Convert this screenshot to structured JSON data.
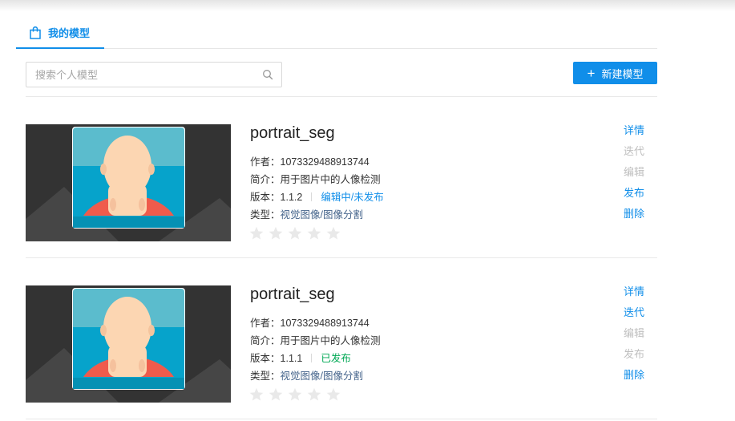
{
  "tabs": [
    {
      "label": "我的模型",
      "active": true
    }
  ],
  "search": {
    "placeholder": "搜索个人模型",
    "value": ""
  },
  "toolbar": {
    "new_model_label": "新建模型"
  },
  "info_labels": {
    "author": "作者：",
    "summary": "简介：",
    "version": "版本：",
    "type": "类型："
  },
  "models": [
    {
      "name": "portrait_seg",
      "author": "1073329488913744",
      "summary": "用于图片中的人像检测",
      "version": "1.1.2",
      "status": "编辑中/未发布",
      "type": "视觉图像/图像分割",
      "rating": 0,
      "actions": [
        {
          "label": "详情",
          "enabled": true
        },
        {
          "label": "迭代",
          "enabled": false
        },
        {
          "label": "编辑",
          "enabled": false
        },
        {
          "label": "发布",
          "enabled": true
        },
        {
          "label": "删除",
          "enabled": true
        }
      ]
    },
    {
      "name": "portrait_seg",
      "author": "1073329488913744",
      "summary": "用于图片中的人像检测",
      "version": "1.1.1",
      "status": "已发布",
      "type": "视觉图像/图像分割",
      "rating": 0,
      "actions": [
        {
          "label": "详情",
          "enabled": true
        },
        {
          "label": "迭代",
          "enabled": true
        },
        {
          "label": "编辑",
          "enabled": false
        },
        {
          "label": "发布",
          "enabled": false
        },
        {
          "label": "删除",
          "enabled": true
        }
      ]
    }
  ],
  "colors": {
    "primary": "#108ee9",
    "published": "#00a854",
    "disabled": "#bfbfbf",
    "star_empty": "#e9e9e9"
  }
}
